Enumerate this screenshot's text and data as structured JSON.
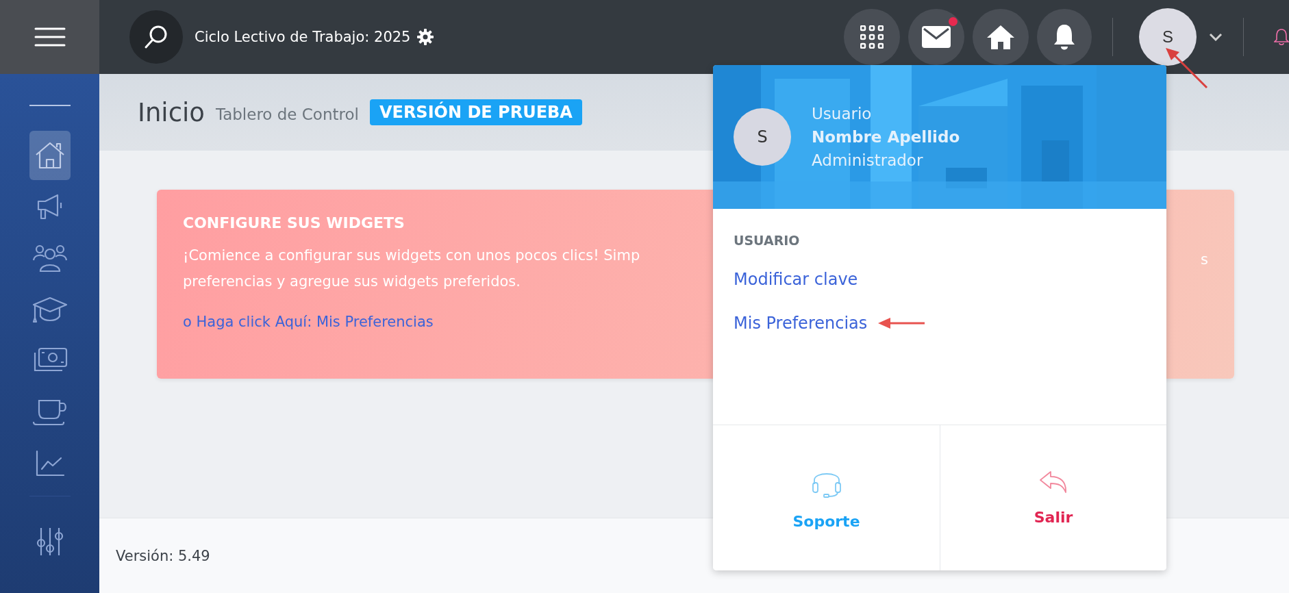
{
  "topbar": {
    "title": "Ciclo Lectivo de Trabajo: 2025",
    "mail_unread": true,
    "avatar_initial": "S"
  },
  "sidebar": {
    "items": [
      {
        "kind": "home",
        "selected": true
      },
      {
        "kind": "megaphone",
        "selected": false
      },
      {
        "kind": "users",
        "selected": false
      },
      {
        "kind": "graduation",
        "selected": false
      },
      {
        "kind": "money",
        "selected": false
      },
      {
        "kind": "coffee",
        "selected": false
      },
      {
        "kind": "chart",
        "selected": false
      }
    ],
    "bottom_items": [
      {
        "kind": "sliders",
        "selected": false
      }
    ]
  },
  "page_header": {
    "title": "Inicio",
    "subtitle": "Tablero de Control",
    "badge": "VERSIÓN DE PRUEBA"
  },
  "alert": {
    "title": "CONFIGURE SUS WIDGETS",
    "body_lines": [
      "¡Comience a configurar sus widgets con unos pocos clics! Simp",
      "preferencias y agregue sus widgets preferidos."
    ],
    "body_tail": "s",
    "link": "o Haga click Aquí: Mis Preferencias"
  },
  "footer": {
    "version": "Versión: 5.49"
  },
  "user_menu": {
    "avatar_initial": "S",
    "caption": "Usuario",
    "name": "Nombre Apellido",
    "role": "Administrador",
    "section": "USUARIO",
    "items": [
      "Modificar clave",
      "Mis Preferencias"
    ],
    "actions": [
      {
        "kind": "support",
        "label": "Soporte"
      },
      {
        "kind": "logout",
        "label": "Salir"
      }
    ]
  }
}
